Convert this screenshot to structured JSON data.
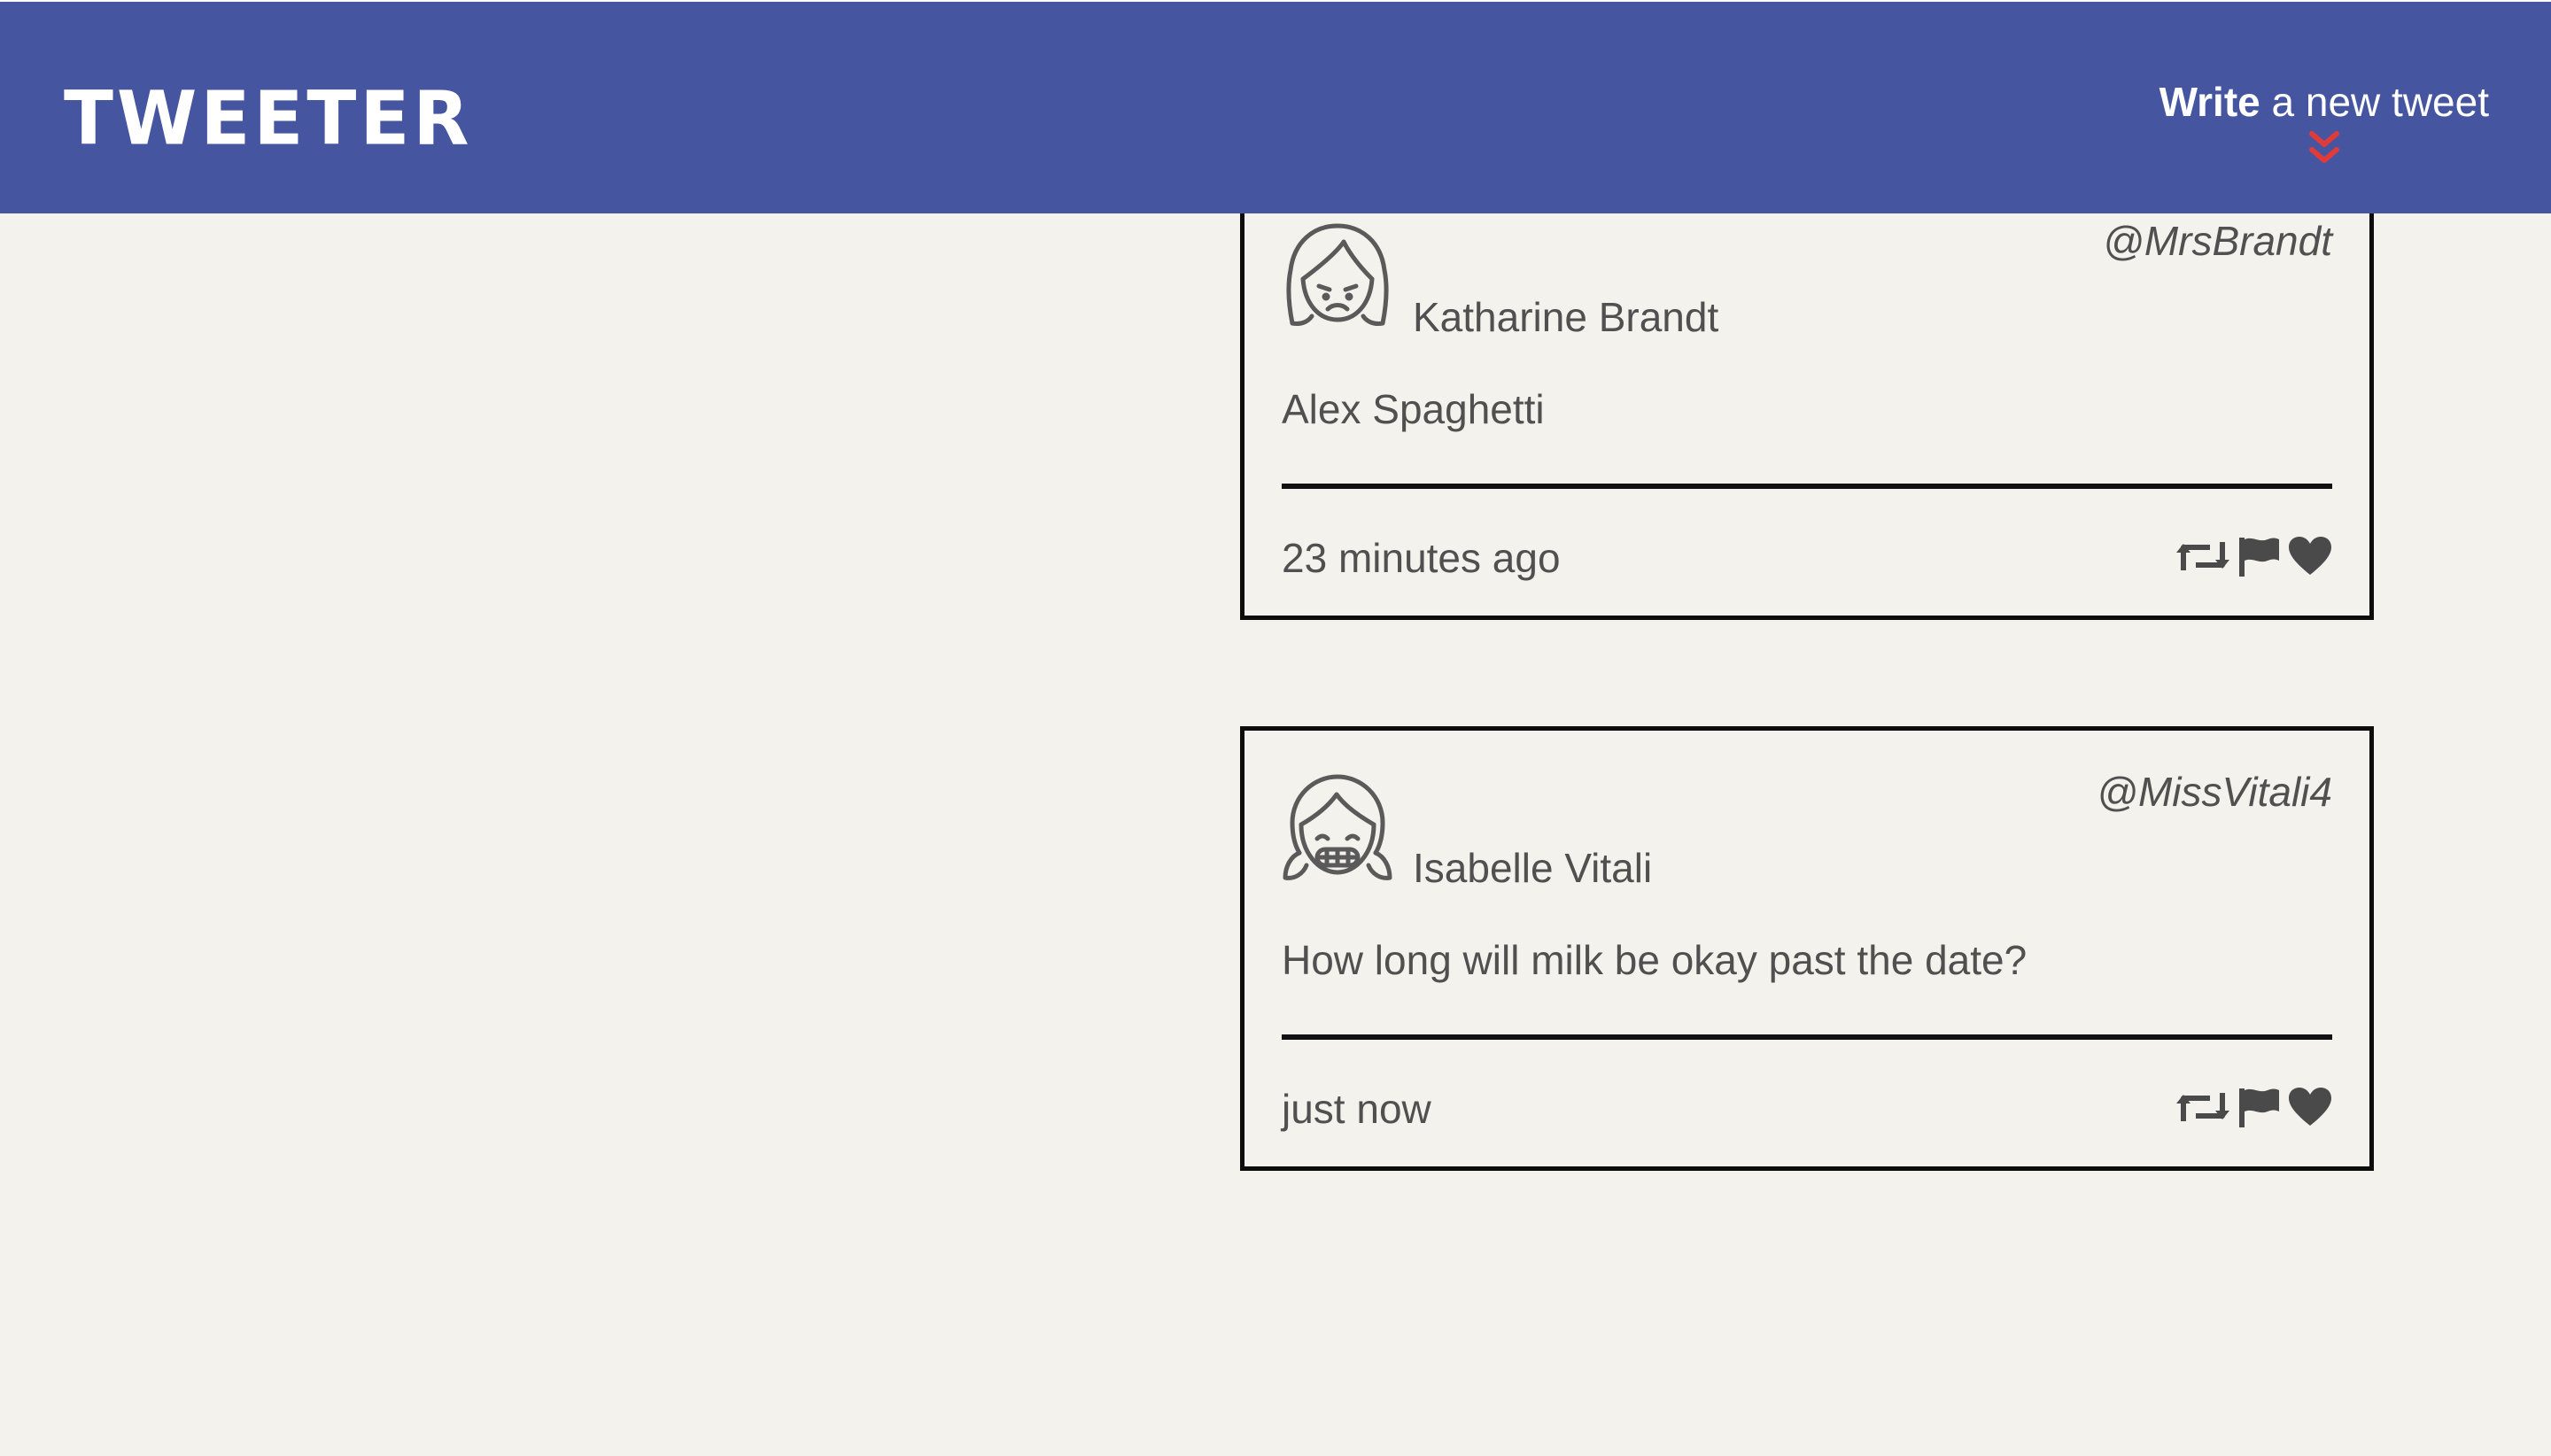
{
  "header": {
    "brand": "TWEETER",
    "compose_strong": "Write",
    "compose_rest": " a new tweet",
    "background_color": "#4555a0",
    "arrow_color": "#e03b3b"
  },
  "tweets": [
    {
      "handle": "@MrsBrandt",
      "name": "Katharine Brandt",
      "avatar_icon": "frowning-girl-avatar-icon",
      "content": "Alex Spaghetti",
      "timestamp": "23 minutes ago"
    },
    {
      "handle": "@MissVitali4",
      "name": "Isabelle Vitali",
      "avatar_icon": "grinning-girl-pigtails-avatar-icon",
      "content": "How long will milk be okay past the date?",
      "timestamp": "just now"
    }
  ],
  "actions": [
    "retweet-icon",
    "flag-icon",
    "heart-icon"
  ]
}
